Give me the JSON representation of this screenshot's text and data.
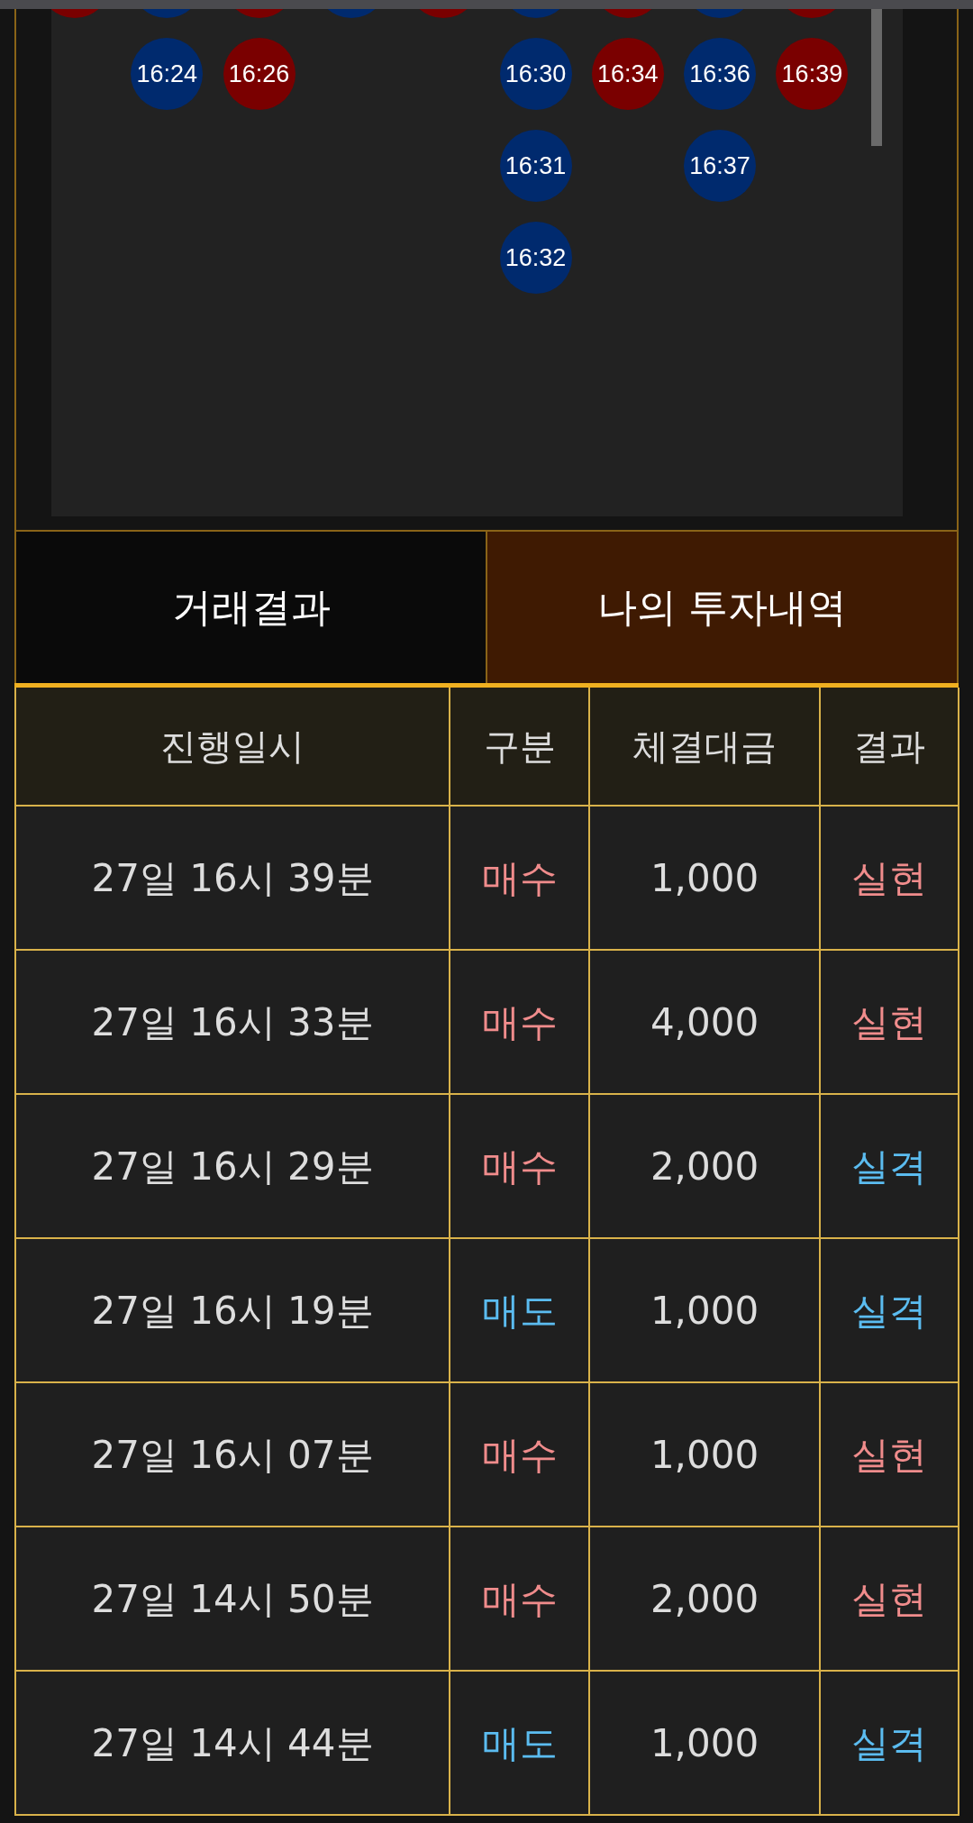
{
  "history_board": {
    "columns": [
      {
        "cells": [
          {
            "color": "#7a0000"
          }
        ]
      },
      {
        "cells": [
          {
            "color": "#002a6e"
          },
          {
            "time": "16:24",
            "color": "#002a6e"
          }
        ]
      },
      {
        "cells": [
          {
            "color": "#7a0000"
          },
          {
            "time": "16:26",
            "color": "#7a0000"
          }
        ]
      },
      {
        "cells": [
          {
            "color": "#002a6e"
          }
        ]
      },
      {
        "cells": [
          {
            "color": "#7a0000"
          }
        ]
      },
      {
        "cells": [
          {
            "color": "#002a6e"
          },
          {
            "time": "16:30",
            "color": "#002a6e"
          },
          {
            "time": "16:31",
            "color": "#002a6e"
          },
          {
            "time": "16:32",
            "color": "#002a6e"
          }
        ]
      },
      {
        "cells": [
          {
            "color": "#7a0000"
          },
          {
            "time": "16:34",
            "color": "#7a0000"
          }
        ]
      },
      {
        "cells": [
          {
            "color": "#002a6e"
          },
          {
            "time": "16:36",
            "color": "#002a6e"
          },
          {
            "time": "16:37",
            "color": "#002a6e"
          }
        ]
      },
      {
        "cells": [
          {
            "color": "#7a0000"
          },
          {
            "time": "16:39",
            "color": "#7a0000"
          }
        ]
      }
    ]
  },
  "tabs": [
    {
      "label": "거래결과",
      "selected": false
    },
    {
      "label": "나의 투자내역",
      "selected": true
    }
  ],
  "table": {
    "columns": [
      "진행일시",
      "구분",
      "체결대금",
      "결과"
    ],
    "rows": [
      {
        "date": "27일 16시 39분",
        "type": {
          "text": "매수",
          "kind": "buy"
        },
        "amount": "1,000",
        "result": {
          "text": "실현",
          "kind": "win"
        }
      },
      {
        "date": "27일 16시 33분",
        "type": {
          "text": "매수",
          "kind": "buy"
        },
        "amount": "4,000",
        "result": {
          "text": "실현",
          "kind": "win"
        }
      },
      {
        "date": "27일 16시 29분",
        "type": {
          "text": "매수",
          "kind": "buy"
        },
        "amount": "2,000",
        "result": {
          "text": "실격",
          "kind": "loss"
        }
      },
      {
        "date": "27일 16시 19분",
        "type": {
          "text": "매도",
          "kind": "sell"
        },
        "amount": "1,000",
        "result": {
          "text": "실격",
          "kind": "loss"
        }
      },
      {
        "date": "27일 16시 07분",
        "type": {
          "text": "매수",
          "kind": "buy"
        },
        "amount": "1,000",
        "result": {
          "text": "실현",
          "kind": "win"
        }
      },
      {
        "date": "27일 14시 50분",
        "type": {
          "text": "매수",
          "kind": "buy"
        },
        "amount": "2,000",
        "result": {
          "text": "실현",
          "kind": "win"
        }
      },
      {
        "date": "27일 14시 44분",
        "type": {
          "text": "매도",
          "kind": "sell"
        },
        "amount": "1,000",
        "result": {
          "text": "실격",
          "kind": "loss"
        }
      }
    ]
  }
}
